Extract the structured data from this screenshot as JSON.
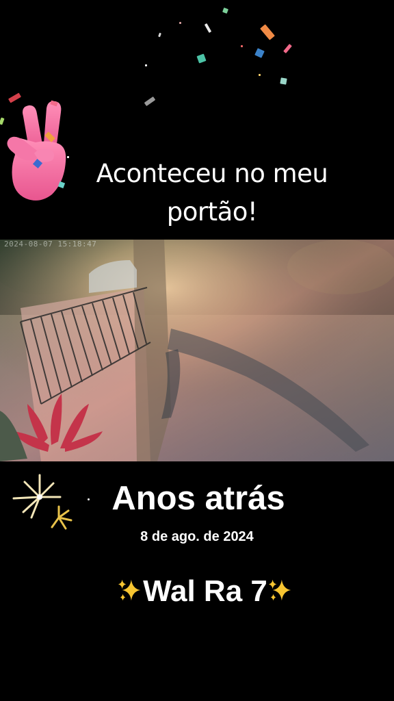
{
  "headline": {
    "text_line1": "Aconteceu no meu",
    "text_line2": "portão!",
    "emoji": "victory-hand-icon"
  },
  "video": {
    "timestamp": "2024-08-07 15:18:47"
  },
  "memory": {
    "title": "Anos atrás",
    "date": "8 de ago. de 2024",
    "username": "Wal Ra 7",
    "decoration_icon": "sparkles-icon",
    "firework_icon": "firework-icon"
  },
  "colors": {
    "background": "#000000",
    "text": "#ffffff",
    "hand_pink": "#f06aa0",
    "sparkle_gold": "#f7c531"
  }
}
